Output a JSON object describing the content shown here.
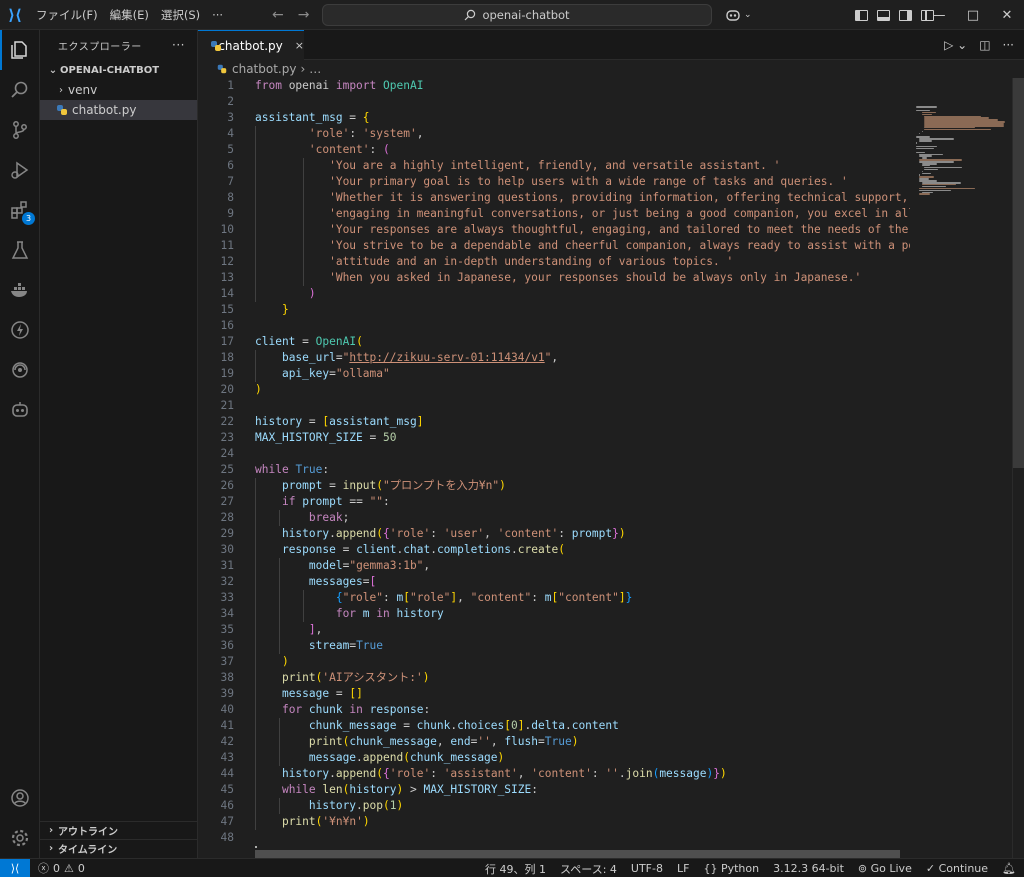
{
  "titlebar": {
    "menu": [
      "ファイル(F)",
      "編集(E)",
      "選択(S)",
      "···"
    ],
    "search_text": "openai-chatbot",
    "search_icon": "search-icon",
    "copilot_icon": "copilot-icon",
    "window_controls": [
      "minimize",
      "maximize",
      "close"
    ]
  },
  "activity_bar": {
    "items": [
      "explorer-icon",
      "search-icon",
      "source-control-icon",
      "run-debug-icon",
      "extensions-icon",
      "testing-icon",
      "docker-icon",
      "thunder-icon",
      "remote-explorer-icon",
      "copilot-chat-icon"
    ],
    "extensions_badge": "3",
    "bottom": [
      "account-icon",
      "manage-gear-icon"
    ]
  },
  "sidebar": {
    "title": "エクスプローラー",
    "more": "···",
    "project": "OPENAI-CHATBOT",
    "tree": [
      {
        "type": "folder",
        "label": "venv"
      },
      {
        "type": "file",
        "label": "chatbot.py"
      }
    ],
    "outline": "アウトライン",
    "timeline": "タイムライン"
  },
  "editor": {
    "tab_label": "chatbot.py",
    "tab_close": "×",
    "breadcrumb_file": "chatbot.py",
    "breadcrumb_rest": "…",
    "line_count": 48,
    "current_line": 49
  },
  "status": {
    "errors": "0",
    "warnings": "0",
    "position": "行 49、列 1",
    "spaces": "スペース: 4",
    "encoding": "UTF-8",
    "eol": "LF",
    "language": "Python",
    "interpreter": "3.12.3 64-bit",
    "golive": "Go Live",
    "continue": "Continue",
    "remote_icon": "remote-icon",
    "bell_icon": "bell-icon"
  },
  "colors": {
    "accent": "#0078d4",
    "keyword": "#c586c0",
    "string": "#ce9178",
    "number": "#b5cea8",
    "variable": "#9cdcfe",
    "function": "#dcdcaa",
    "builtin_const": "#569cd6"
  }
}
